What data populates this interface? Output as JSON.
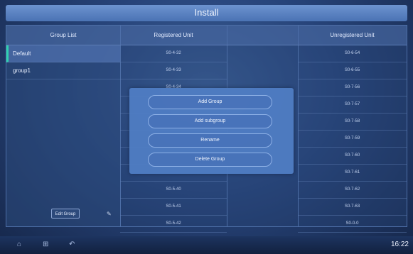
{
  "app": {
    "title": "Install"
  },
  "group_list": {
    "header": "Group List",
    "items": [
      {
        "label": "Default",
        "selected": true
      },
      {
        "label": "group1",
        "selected": false
      }
    ],
    "edit_button": "Edit Group"
  },
  "registered": {
    "header": "Registered Unit",
    "units": [
      "S0-4-32",
      "S0-4-33",
      "S0-4-34",
      "S0-5-40",
      "S0-5-41",
      "S0-5-42"
    ]
  },
  "unregistered": {
    "header": "Unregistered Unit",
    "units": [
      "S0-6-54",
      "S0-6-55",
      "S0-7-56",
      "S0-7-57",
      "S0-7-58",
      "S0-7-59",
      "S0-7-60",
      "S0-7-61",
      "S0-7-62",
      "S0-7-63",
      "S0-0-0"
    ]
  },
  "popup": {
    "buttons": [
      "Add Group",
      "Add subgroup",
      "Rename",
      "Delete Group"
    ]
  },
  "taskbar": {
    "icons": [
      "home-icon",
      "apps-icon",
      "back-icon"
    ],
    "clock": "16:22"
  },
  "colors": {
    "accent": "#2fd1b0",
    "title_bar": "#5b82c3",
    "popup": "#507dc3"
  }
}
